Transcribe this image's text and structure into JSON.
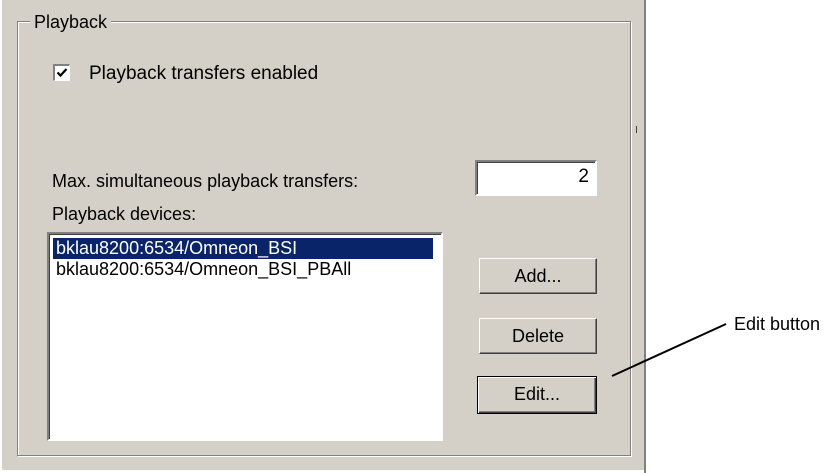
{
  "group": {
    "title": "Playback"
  },
  "checkbox": {
    "label": "Playback transfers enabled",
    "checked": true
  },
  "max_transfers": {
    "label": "Max. simultaneous playback transfers:",
    "value": "2"
  },
  "devices": {
    "label": "Playback devices:",
    "items": [
      {
        "text": "bklau8200:6534/Omneon_BSI",
        "selected": true
      },
      {
        "text": "bklau8200:6534/Omneon_BSI_PBAll",
        "selected": false
      }
    ]
  },
  "buttons": {
    "add": "Add...",
    "delete": "Delete",
    "edit": "Edit..."
  },
  "callout": {
    "label": "Edit button"
  },
  "colors": {
    "panel": "#d4d0c8",
    "selection": "#0a246a"
  }
}
